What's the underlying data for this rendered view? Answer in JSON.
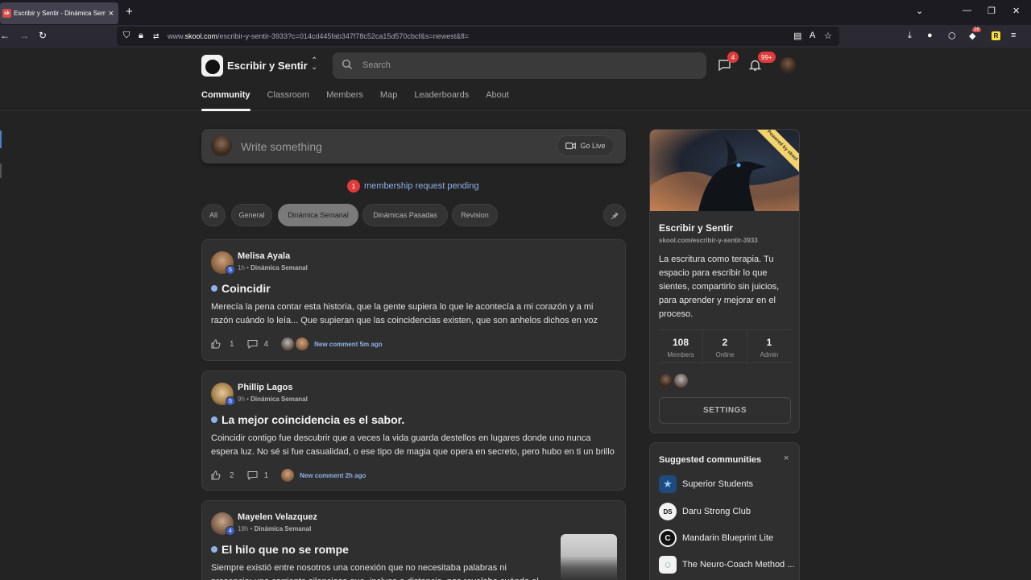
{
  "browser": {
    "tab_title": "Escribir y Sentir - Dinámica Semanal",
    "tab_favicon_text": "sk",
    "url_prefix": "www.",
    "url_domain": "skool.com",
    "url_rest": "/escribir-y-sentir-3933?c=014cd445fab347f78c52ca15d570cbcf&s=newest&fl=",
    "extension_badge": "26",
    "ext_r_label": "R"
  },
  "header": {
    "community_name": "Escribir y Sentir",
    "search_placeholder": "Search",
    "chat_badge": "4",
    "notif_badge": "99+"
  },
  "nav": {
    "items": [
      "Community",
      "Classroom",
      "Members",
      "Map",
      "Leaderboards",
      "About"
    ],
    "active": "Community"
  },
  "composer": {
    "placeholder": "Write something",
    "go_live": "Go Live"
  },
  "pending": {
    "count": "1",
    "text": "membership request pending"
  },
  "filters": {
    "chips": [
      "All",
      "General",
      "Dinámica Semanal",
      "Dinámicas Pasadas",
      "Revision"
    ],
    "active": "Dinámica Semanal"
  },
  "posts": [
    {
      "author": "Melisa Ayala",
      "level": "5",
      "time": "1h",
      "category": "Dinámica Semanal",
      "title": "Coincidir",
      "body": "Merecía la pena contar esta historia, que la gente supiera lo que le acontecía a mi corazón y a mi razón cuándo lo leía... Que supieran que las coincidencias existen, que son anhelos dichos en voz baja, que el",
      "likes": "1",
      "comments": "4",
      "new_comment": "New comment 5m ago"
    },
    {
      "author": "Phillip Lagos",
      "level": "5",
      "time": "9h",
      "category": "Dinámica Semanal",
      "title": "La mejor coincidencia es el sabor.",
      "body": "Coincidir contigo fue descubrir que a veces la vida guarda destellos en lugares donde uno nunca espera luz. No sé si fue casualidad, o ese tipo de magia que opera en secreto, pero hubo en ti un brillo tibio,",
      "likes": "2",
      "comments": "1",
      "new_comment": "New comment 2h ago"
    },
    {
      "author": "Mayelen Velazquez",
      "level": "4",
      "time": "18h",
      "category": "Dinámica Semanal",
      "title": "El hilo que no se rompe",
      "body": "Siempre existió entre nosotros una conexión que no necesitaba palabras ni presencia; una corriente silenciosa que, incluso a distancia, nos revelaba cuándo el uno cansaba"
    }
  ],
  "sidebar": {
    "ribbon": "Powered by skool",
    "name": "Escribir y Sentir",
    "url": "skool.com/escribir-y-sentir-3933",
    "description": "La escritura como terapia. Tu espacio para escribir lo que sientes, compartirlo sin juicios, para aprender y mejorar en el proceso.",
    "stats": [
      {
        "value": "108",
        "label": "Members"
      },
      {
        "value": "2",
        "label": "Online"
      },
      {
        "value": "1",
        "label": "Admin"
      }
    ],
    "settings_label": "SETTINGS"
  },
  "suggested": {
    "title": "Suggested communities",
    "close": "×",
    "items": [
      "Superior Students",
      "Daru Strong Club",
      "Mandarin Blueprint Lite",
      "The Neuro-Coach Method ..."
    ]
  }
}
